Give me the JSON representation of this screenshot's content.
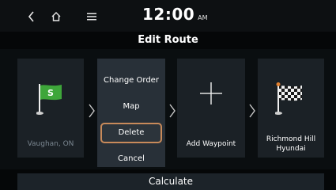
{
  "status_bar": {
    "time": "12:00",
    "ampm": "AM",
    "back_icon": "chevron-left-icon",
    "home_icon": "home-icon",
    "menu_icon": "hamburger-menu-icon"
  },
  "title": "Edit Route",
  "route": {
    "start": {
      "label": "Vaughan, ON",
      "icon": "green-flag-s-icon"
    },
    "waypoint": {
      "label": "Add Waypoint",
      "icon": "plus-icon"
    },
    "destination": {
      "label_line1": "Richmond Hill",
      "label_line2": "Hyundai",
      "icon": "checkered-flag-icon"
    }
  },
  "context_menu": {
    "items": [
      {
        "label": "Change Order"
      },
      {
        "label": "Map"
      },
      {
        "label": "Delete",
        "focused": true
      },
      {
        "label": "Cancel"
      }
    ]
  },
  "calculate_label": "Calculate",
  "colors": {
    "background": "#050708",
    "card": "#1b2126",
    "menu": "#283038",
    "focus_border": "#c88a5a",
    "flag_green": "#3ea63a"
  }
}
